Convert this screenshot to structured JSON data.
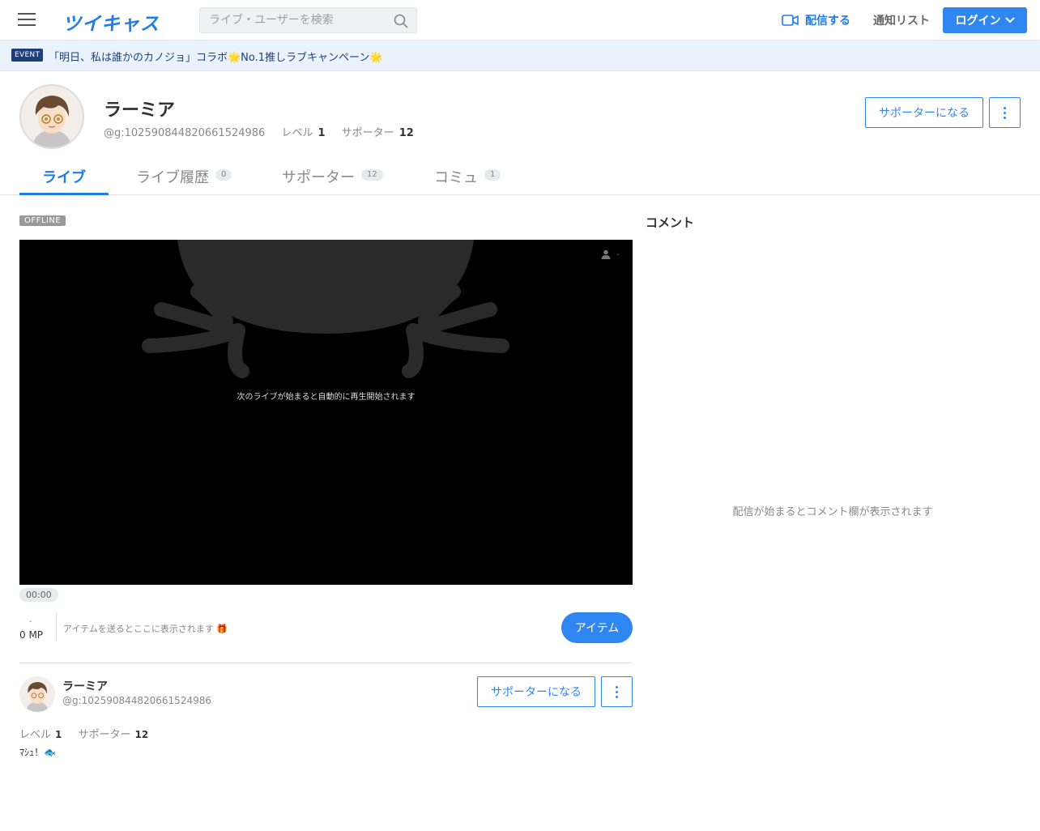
{
  "header": {
    "logo": "ツイキャス",
    "search_placeholder": "ライブ・ユーザーを検索",
    "broadcast_label": "配信する",
    "notify_label": "通知リスト",
    "login_label": "ログイン"
  },
  "event": {
    "badge": "EVENT",
    "text": "「明日、私は誰かのカノジョ」コラボ🌟No.1推しラブキャンペーン🌟"
  },
  "profile": {
    "name": "ラーミア",
    "id": "@g:102590844820661524986",
    "level_label": "レベル",
    "level_value": "1",
    "supporter_label": "サポーター",
    "supporter_value": "12",
    "become_supporter": "サポーターになる"
  },
  "tabs": [
    {
      "label": "ライブ"
    },
    {
      "label": "ライブ履歴",
      "count": "0"
    },
    {
      "label": "サポーター",
      "count": "12"
    },
    {
      "label": "コミュ",
      "count": "1"
    }
  ],
  "player": {
    "status": "OFFLINE",
    "message": "次のライブが始まると自動的に再生開始されます",
    "viewers": "-",
    "time": "00:00"
  },
  "items": {
    "mp_dash": "-",
    "mp": "0 MP",
    "hint": "アイテムを送るとここに表示されます 🎁",
    "button": "アイテム"
  },
  "profile_card": {
    "name": "ラーミア",
    "id": "@g:102590844820661524986",
    "level_label": "レベル",
    "level_value": "1",
    "supporter_label": "サポーター",
    "supporter_value": "12",
    "bio": "ﾏｼｭ！🐟",
    "become_supporter": "サポーターになる"
  },
  "comments": {
    "title": "コメント",
    "empty": "配信が始まるとコメント欄が表示されます"
  },
  "colors": {
    "accent": "#2f86f0",
    "logo": "#1f7ce8",
    "event_bg": "#eaf3fc",
    "event_badge": "#1e3f7a"
  }
}
